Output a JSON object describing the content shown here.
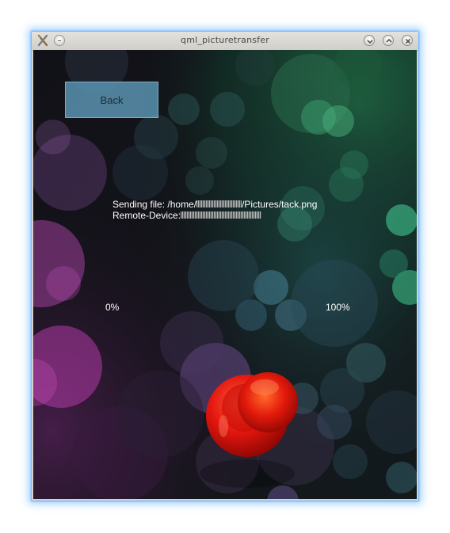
{
  "window": {
    "title": "qml_picturetransfer"
  },
  "content": {
    "back_label": "Back",
    "sending_label": "Sending file: /home/",
    "file_path_tail": "/Pictures/tack.png",
    "remote_label": "Remote-Device:",
    "progress": {
      "min_label": "0%",
      "max_label": "100%",
      "value": 0
    }
  },
  "icons": {
    "app": "x-tools-icon",
    "window_menu": "window-menu-icon",
    "minimize": "chevron-down-icon",
    "maximize": "chevron-up-icon",
    "close": "close-icon"
  }
}
